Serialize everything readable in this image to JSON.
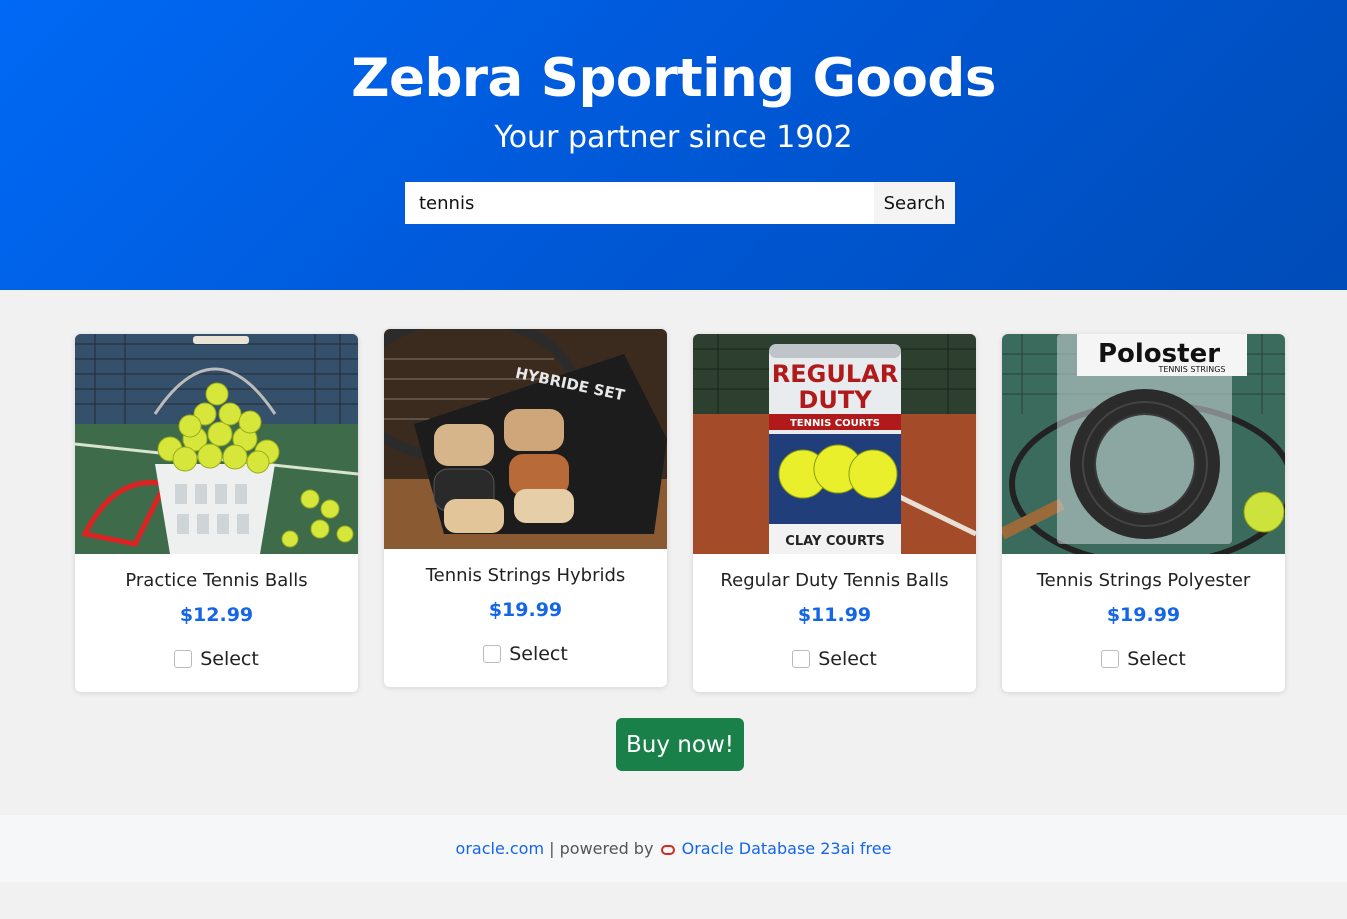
{
  "header": {
    "title": "Zebra Sporting Goods",
    "tagline": "Your partner since 1902"
  },
  "search": {
    "value": "tennis",
    "button_label": "Search"
  },
  "products": [
    {
      "name": "Practice Tennis Balls",
      "price": "$12.99",
      "select_label": "Select",
      "image": "tennis-balls-bucket"
    },
    {
      "name": "Tennis Strings Hybrids",
      "price": "$19.99",
      "select_label": "Select",
      "image": "hybrid-string-set"
    },
    {
      "name": "Regular Duty Tennis Balls",
      "price": "$11.99",
      "select_label": "Select",
      "image": "regular-duty-can"
    },
    {
      "name": "Tennis Strings Polyester",
      "price": "$19.99",
      "select_label": "Select",
      "image": "poloster-string-pack"
    }
  ],
  "product_image_text": {
    "strings_brand": "HYBRIDE SET",
    "can_line1": "REGULAR",
    "can_line2": "DUTY",
    "can_line3": "TENNIS COURTS",
    "can_bottom": "CLAY COURTS",
    "poly_brand": "Poloster",
    "poly_sub": "TENNIS STRINGS"
  },
  "buy_label": "Buy now!",
  "footer": {
    "link1": "oracle.com",
    "separator": "| powered by",
    "link2": "Oracle Database 23ai free"
  },
  "colors": {
    "hero_start": "#0069f5",
    "hero_end": "#004cb8",
    "price": "#1565e8",
    "buy_button": "#19804a"
  }
}
